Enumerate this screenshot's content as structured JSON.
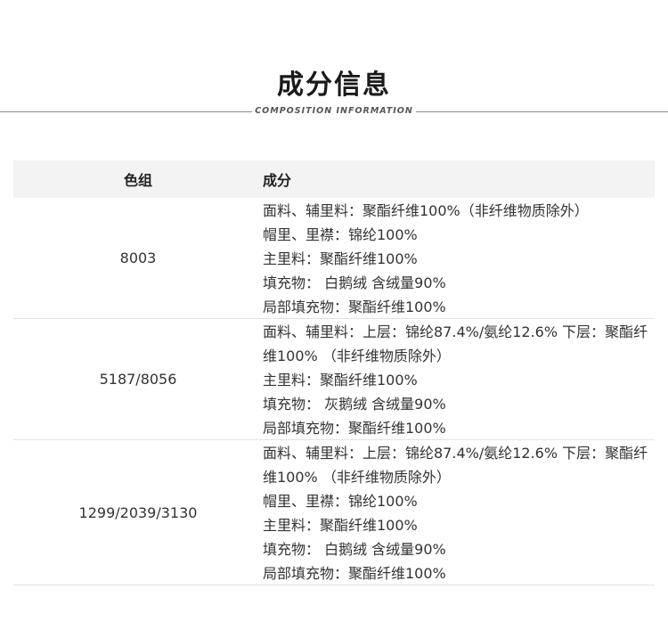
{
  "header": {
    "title": "成分信息",
    "subtitle": "COMPOSITION INFORMATION"
  },
  "table": {
    "columns": [
      "色组",
      "成分"
    ],
    "rows": [
      {
        "color_group": "8003",
        "composition": [
          "面料、辅里料：聚酯纤维100%（非纤维物质除外）",
          "帽里、里襟：锦纶100%",
          "主里料：聚酯纤维100%",
          "填充物： 白鹅绒 含绒量90%",
          "局部填充物：聚酯纤维100%"
        ]
      },
      {
        "color_group": "5187/8056",
        "composition": [
          "面料、辅里料：上层：锦纶87.4%/氨纶12.6% 下层：聚酯纤维100% （非纤维物质除外）",
          "主里料：聚酯纤维100%",
          "填充物： 灰鹅绒 含绒量90%",
          "局部填充物：聚酯纤维100%"
        ]
      },
      {
        "color_group": "1299/2039/3130",
        "composition": [
          "面料、辅里料：上层：锦纶87.4%/氨纶12.6% 下层：聚酯纤维100% （非纤维物质除外）",
          "帽里、里襟：锦纶100%",
          "主里料：聚酯纤维100%",
          "填充物： 白鹅绒 含绒量90%",
          "局部填充物：聚酯纤维100%"
        ]
      }
    ]
  }
}
